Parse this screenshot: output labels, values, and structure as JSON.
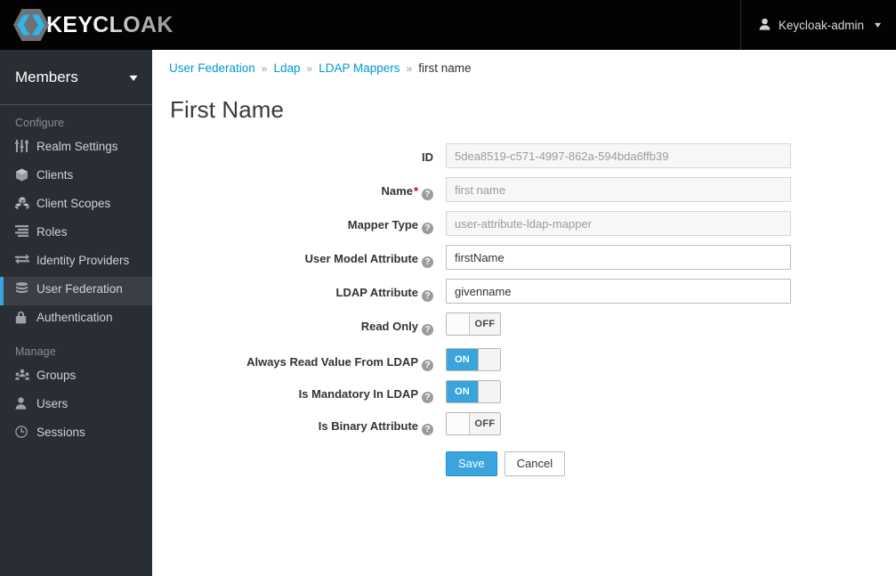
{
  "header": {
    "brand": "KEYCLOAK",
    "user": "Keycloak-admin"
  },
  "sidebar": {
    "realm": "Members",
    "sections": [
      {
        "title": "Configure",
        "items": [
          {
            "label": "Realm Settings",
            "icon": "sliders-icon",
            "active": false
          },
          {
            "label": "Clients",
            "icon": "cube-icon",
            "active": false
          },
          {
            "label": "Client Scopes",
            "icon": "cubes-icon",
            "active": false
          },
          {
            "label": "Roles",
            "icon": "roles-list-icon",
            "active": false
          },
          {
            "label": "Identity Providers",
            "icon": "exchange-arrows-icon",
            "active": false
          },
          {
            "label": "User Federation",
            "icon": "database-icon",
            "active": true
          },
          {
            "label": "Authentication",
            "icon": "lock-icon",
            "active": false
          }
        ]
      },
      {
        "title": "Manage",
        "items": [
          {
            "label": "Groups",
            "icon": "groups-icon",
            "active": false
          },
          {
            "label": "Users",
            "icon": "user-icon",
            "active": false
          },
          {
            "label": "Sessions",
            "icon": "clock-icon",
            "active": false
          }
        ]
      }
    ]
  },
  "breadcrumb": {
    "items": [
      {
        "label": "User Federation",
        "link": true
      },
      {
        "label": "Ldap",
        "link": true
      },
      {
        "label": "LDAP Mappers",
        "link": true
      },
      {
        "label": "first name",
        "link": false
      }
    ],
    "separator": "»"
  },
  "page": {
    "title": "First Name"
  },
  "form": {
    "fields": [
      {
        "label": "ID",
        "required": false,
        "help": false,
        "type": "text",
        "value": "5dea8519-c571-4997-862a-594bda6ffb39",
        "disabled": true
      },
      {
        "label": "Name",
        "required": true,
        "help": true,
        "type": "text",
        "value": "first name",
        "disabled": true
      },
      {
        "label": "Mapper Type",
        "required": false,
        "help": true,
        "type": "text",
        "value": "user-attribute-ldap-mapper",
        "disabled": true
      },
      {
        "label": "User Model Attribute",
        "required": false,
        "help": true,
        "type": "text",
        "value": "firstName",
        "disabled": false
      },
      {
        "label": "LDAP Attribute",
        "required": false,
        "help": true,
        "type": "text",
        "value": "givenname",
        "disabled": false
      },
      {
        "label": "Read Only",
        "required": false,
        "help": true,
        "type": "toggle",
        "value": "OFF"
      },
      {
        "label": "Always Read Value From LDAP",
        "required": false,
        "help": true,
        "type": "toggle",
        "value": "ON"
      },
      {
        "label": "Is Mandatory In LDAP",
        "required": false,
        "help": true,
        "type": "toggle",
        "value": "ON"
      },
      {
        "label": "Is Binary Attribute",
        "required": false,
        "help": true,
        "type": "toggle",
        "value": "OFF"
      }
    ],
    "save_label": "Save",
    "cancel_label": "Cancel",
    "help_glyph": "?",
    "required_glyph": "*"
  },
  "colors": {
    "accent": "#39a5dc",
    "link": "#0099d3",
    "sidebar_bg": "#292e34",
    "sidebar_active_bg": "#393f45",
    "topbar_bg": "#030303",
    "required_red": "#cc0000"
  }
}
